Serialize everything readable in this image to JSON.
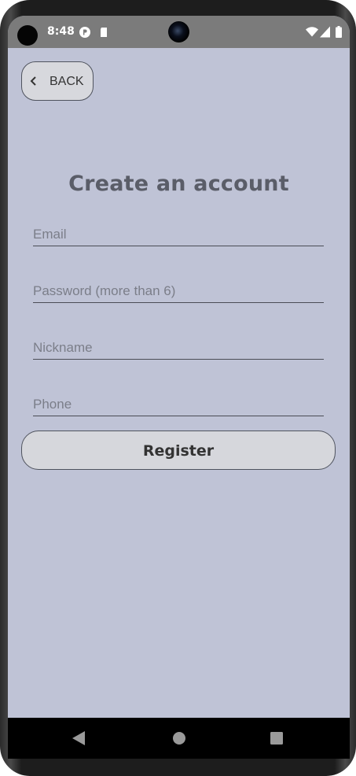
{
  "status_bar": {
    "time": "8:48",
    "icons": [
      "p-notification-icon",
      "sd-card-icon",
      "wifi-icon",
      "cell-signal-icon",
      "battery-icon"
    ]
  },
  "header": {
    "back_label": "BACK"
  },
  "form": {
    "title": "Create an account",
    "email_placeholder": "Email",
    "password_placeholder": "Password (more than 6)",
    "nickname_placeholder": "Nickname",
    "phone_placeholder": "Phone",
    "register_label": "Register"
  },
  "nav_bar": {
    "buttons": [
      "back-triangle-icon",
      "home-circle-icon",
      "recents-square-icon"
    ]
  },
  "colors": {
    "background": "#bfc3d6",
    "status_bar": "#7b7b7b",
    "button_fill": "#d6d7dc",
    "title_text": "#5a5d68"
  }
}
